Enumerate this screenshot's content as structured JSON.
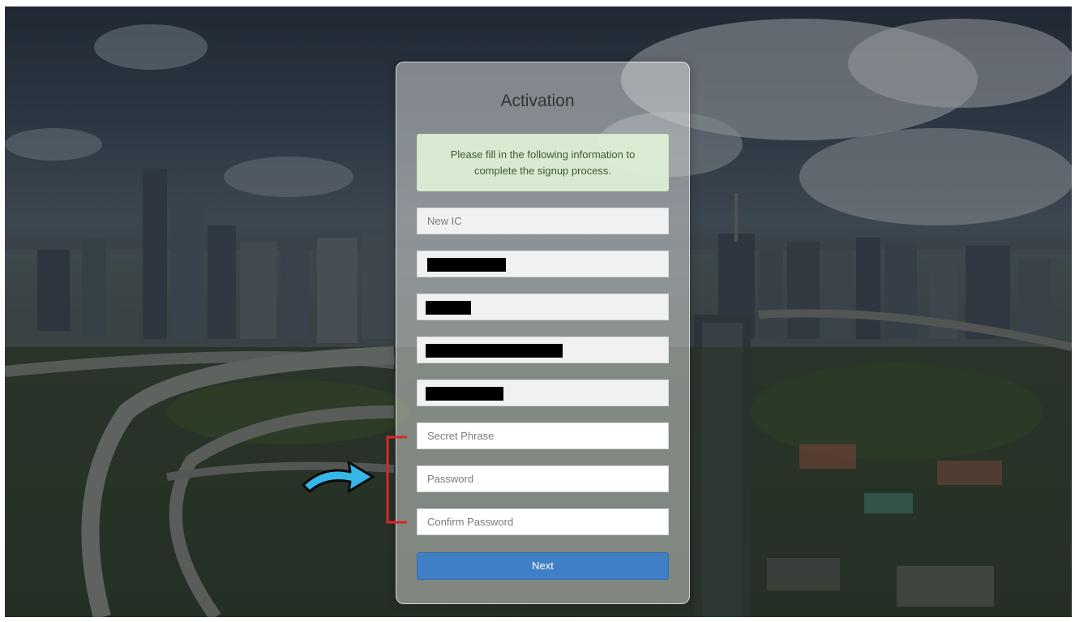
{
  "form": {
    "title": "Activation",
    "notice": "Please fill in the following information to complete the signup process.",
    "fields": [
      {
        "placeholder": "New IC",
        "value": ""
      },
      {
        "placeholder": "",
        "value": "",
        "redacted": true
      },
      {
        "placeholder": "",
        "value": "",
        "redacted": true
      },
      {
        "placeholder": "",
        "value": "",
        "redacted": true
      },
      {
        "placeholder": "",
        "value": "",
        "redacted": true
      },
      {
        "placeholder": "Secret Phrase",
        "value": ""
      },
      {
        "placeholder": "Password",
        "value": ""
      },
      {
        "placeholder": "Confirm Password",
        "value": ""
      }
    ],
    "next_label": "Next"
  },
  "annotations": {
    "bracket_color": "#d9282a",
    "arrow_color": "#35b7e8"
  }
}
